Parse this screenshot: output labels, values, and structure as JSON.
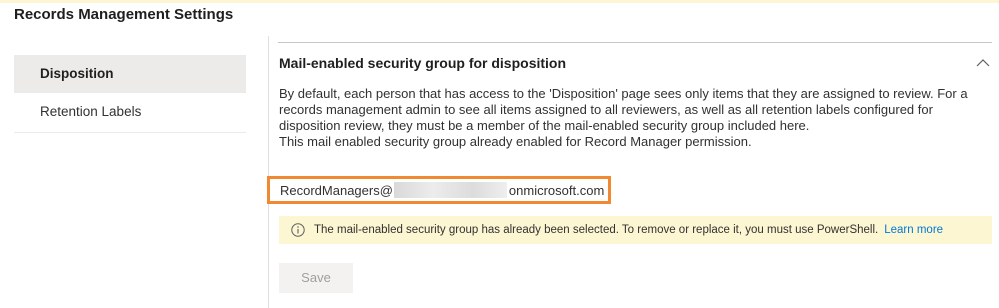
{
  "page": {
    "title": "Records Management Settings"
  },
  "sidebar": {
    "items": [
      {
        "label": "Disposition",
        "active": true
      },
      {
        "label": "Retention Labels",
        "active": false
      }
    ]
  },
  "section": {
    "title": "Mail-enabled security group for disposition",
    "chevron_icon": "chevron-up-icon",
    "description_lines": [
      "By default, each person that has access to the 'Disposition' page sees only items that they are assigned to review. For a",
      "records management admin to see all items assigned to all reviewers, as well as all retention labels configured for",
      "disposition review, they must be a member of the mail-enabled security group included here.",
      "This mail enabled security group already enabled for Record Manager permission."
    ],
    "email": {
      "prefix": "RecordManagers@",
      "suffix": "onmicrosoft.com",
      "highlight_color": "#f0892f"
    },
    "info_bar": {
      "icon": "info-icon",
      "message": "The mail-enabled security group has already been selected. To remove or replace it, you must use PowerShell.",
      "link_label": "Learn more",
      "background": "#fdf6d3"
    },
    "save_label": "Save"
  },
  "colors": {
    "accent_link": "#0078d4",
    "highlight": "#f0892f",
    "info_bg": "#fdf6d3"
  }
}
